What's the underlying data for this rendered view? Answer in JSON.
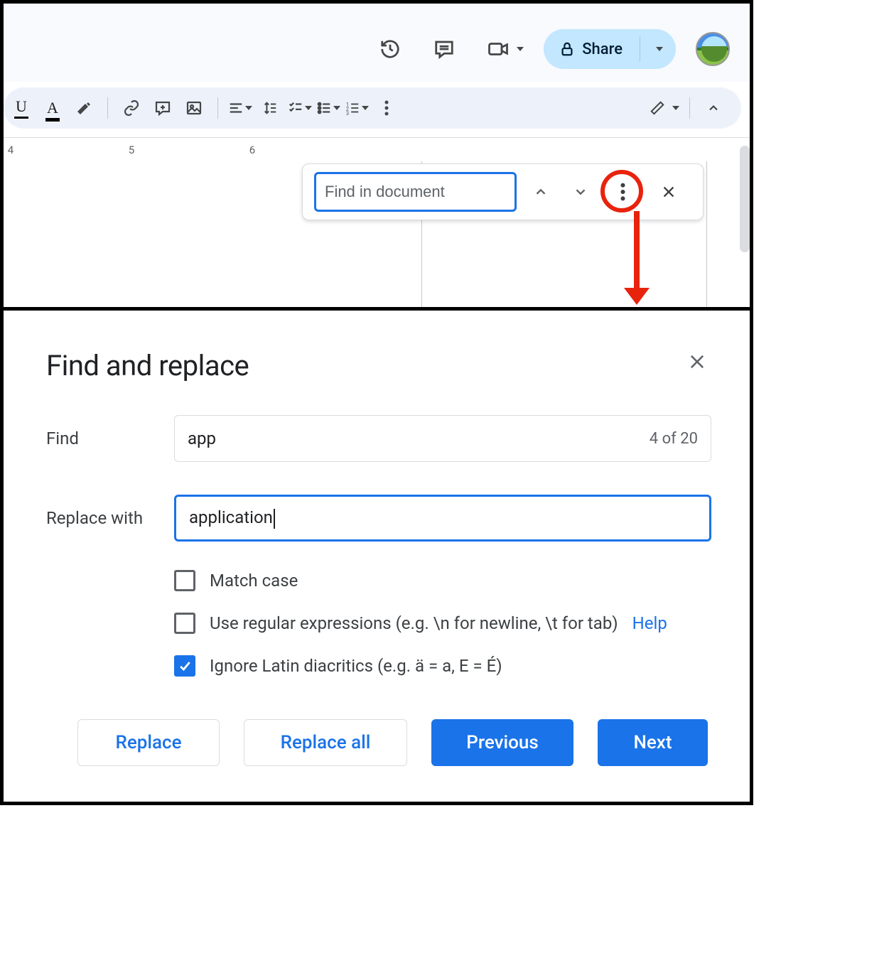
{
  "header": {
    "share_label": "Share"
  },
  "ruler": {
    "marks": [
      "4",
      "5",
      "6"
    ]
  },
  "find_bar": {
    "placeholder": "Find in document"
  },
  "dialog": {
    "title": "Find and replace",
    "find_label": "Find",
    "find_value": "app",
    "count_text": "4 of 20",
    "replace_label": "Replace with",
    "replace_value": "application",
    "options": {
      "match_case": {
        "label": "Match case",
        "checked": false
      },
      "regex": {
        "label": "Use regular expressions (e.g. \\n for newline, \\t for tab)",
        "checked": false,
        "help": "Help"
      },
      "diacritics": {
        "label": "Ignore Latin diacritics (e.g. ä = a, E = É)",
        "checked": true
      }
    },
    "buttons": {
      "replace": "Replace",
      "replace_all": "Replace all",
      "previous": "Previous",
      "next": "Next"
    }
  }
}
